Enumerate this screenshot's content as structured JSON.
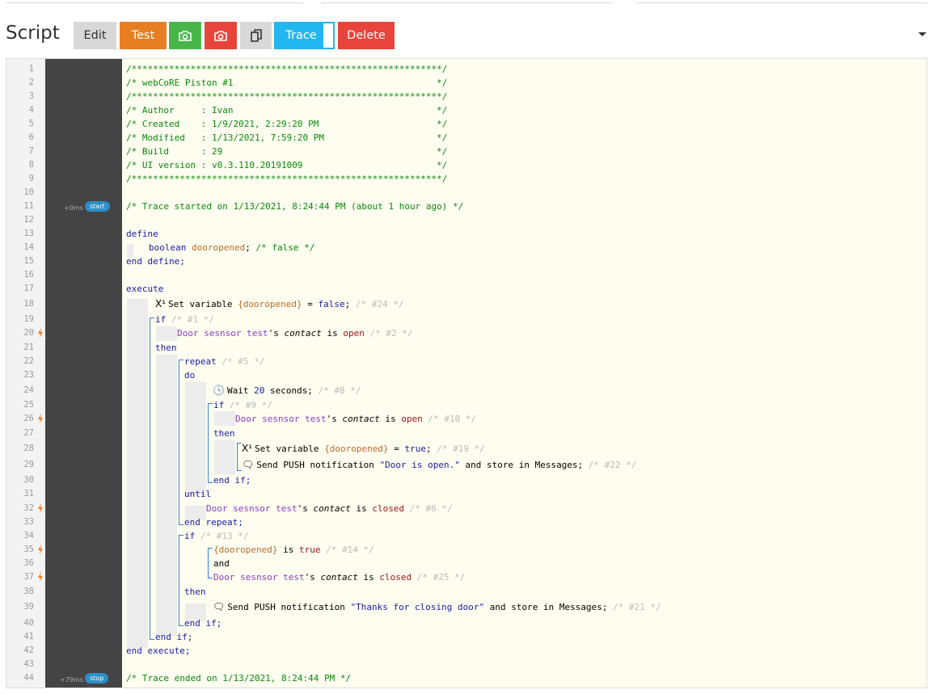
{
  "header": {
    "title": "Script",
    "buttons": {
      "edit": "Edit",
      "test": "Test",
      "trace": "Trace",
      "delete": "Delete"
    }
  },
  "trace": {
    "start_time": "+0ms",
    "start_label": "start",
    "stop_time": "+79ms",
    "stop_label": "stop"
  },
  "lines": {
    "l1": "/**********************************************************/",
    "l2": "/* webCoRE Piston #1                                      */",
    "l3": "/**********************************************************/",
    "l4": "/* Author     : Ivan                                      */",
    "l5": "/* Created    : 1/9/2021, 2:29:20 PM                      */",
    "l6": "/* Modified   : 1/13/2021, 7:59:20 PM                     */",
    "l7": "/* Build      : 29                                        */",
    "l8": "/* UI version : v0.3.110.20191009                         */",
    "l9": "/**********************************************************/",
    "l11": "/* Trace started on 1/13/2021, 8:24:44 PM (about 1 hour ago) */",
    "l44": "/* Trace ended on 1/13/2021, 8:24:44 PM */"
  },
  "code": {
    "kw_define": "define",
    "kw_end_define": "end define;",
    "kw_boolean": "boolean",
    "var_dooropened": "dooropened",
    "var_braced": "{dooropened}",
    "cmt_false": "/* false */",
    "kw_execute": "execute",
    "kw_end_execute": "end execute;",
    "set_variable": "Set variable",
    "eq": "=",
    "lit_false": "false",
    "lit_true": "true",
    "cmt_24": "/* #24 */",
    "kw_if": "if",
    "cmt_1": "/* #1 */",
    "device": "Door sesnsor test",
    "apos_s": "'s",
    "attr_contact": "contact",
    "kw_is": "is",
    "lit_open": "open",
    "lit_closed": "closed",
    "cmt_2": "/* #2 */",
    "kw_then": "then",
    "kw_repeat": "repeat",
    "cmt_5": "/* #5 */",
    "kw_do": "do",
    "wait": "Wait",
    "num_20": "20",
    "seconds": "seconds;",
    "cmt_8": "/* #8 */",
    "cmt_9": "/* #9 */",
    "cmt_10": "/* #10 */",
    "cmt_19": "/* #19 */",
    "send_push": "Send PUSH notification",
    "msg_open": "\"Door is open.\"",
    "store": "and store in Messages;",
    "cmt_22": "/* #22 */",
    "kw_end_if": "end if;",
    "kw_until": "until",
    "cmt_6": "/* #6 */",
    "kw_end_repeat": "end repeat;",
    "cmt_13": "/* #13 */",
    "cmt_14": "/* #14 */",
    "kw_and": "and",
    "cmt_25": "/* #25 */",
    "msg_thanks": "\"Thanks for closing door\"",
    "cmt_21": "/* #21 */",
    "semi": ";"
  },
  "icons": {
    "x1": "x1-variable-icon",
    "clock": "clock-icon",
    "comment": "comment-icon",
    "bolt": "lightning-bolt-icon",
    "camera": "camera-icon",
    "duplicate": "duplicate-icon",
    "caret": "chevron-down-icon"
  },
  "colors": {
    "test": "#e87e22",
    "snapshot_green": "#46b649",
    "snapshot_red": "#e9443c",
    "trace": "#22b7f0",
    "delete": "#e9443c",
    "trace_bg": "#444444",
    "code_bg": "#fdfdf0"
  }
}
